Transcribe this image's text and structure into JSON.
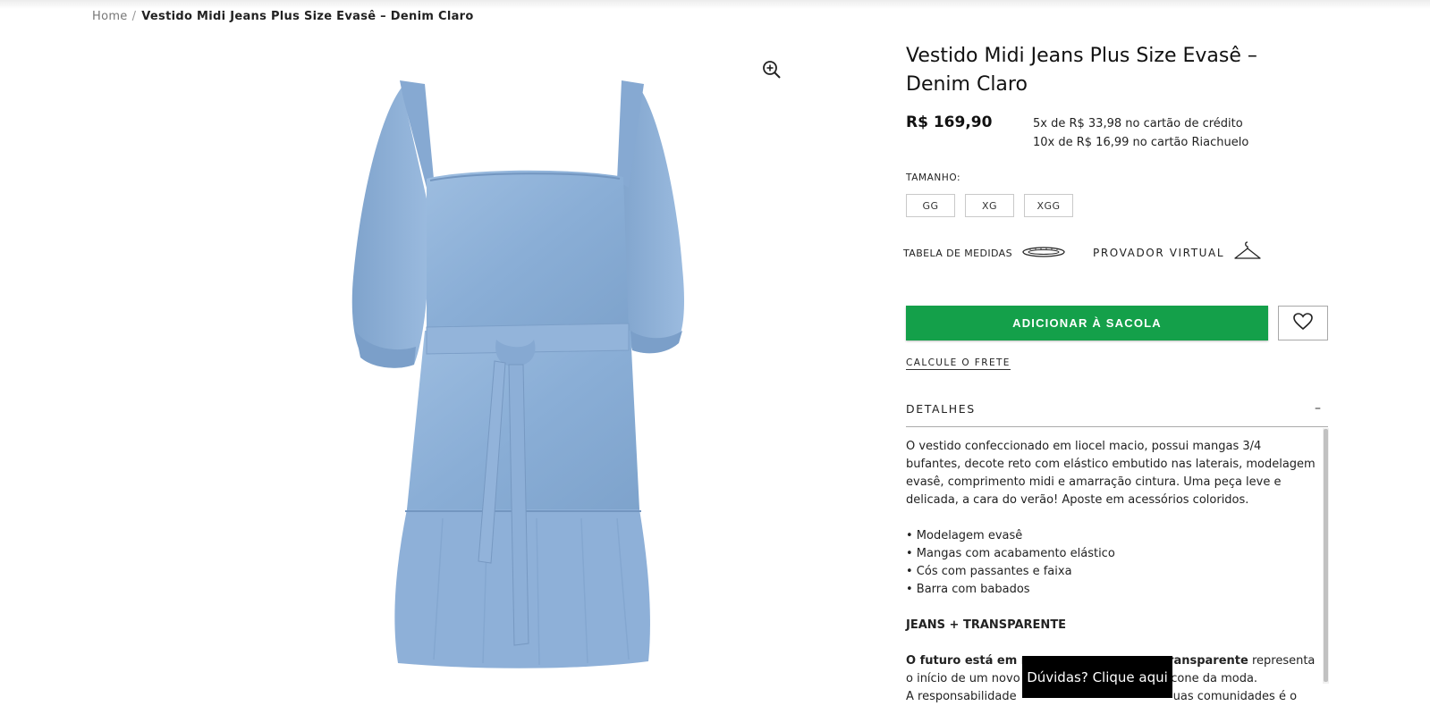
{
  "breadcrumb": {
    "home": "Home",
    "separator": "/",
    "current": "Vestido Midi Jeans Plus Size Evasê – Denim Claro"
  },
  "product": {
    "title": "Vestido Midi Jeans Plus Size Evasê – Denim Claro",
    "price": "R$ 169,90",
    "installments": [
      "5x de R$ 33,98 no cartão de crédito",
      "10x de R$ 16,99 no cartão Riachuelo"
    ],
    "image_icon": "denim-dress-image",
    "zoom_icon": "zoom-in-icon"
  },
  "size": {
    "label": "TAMANHO:",
    "options": [
      "GG",
      "XG",
      "XGG"
    ]
  },
  "links": {
    "measure_table": "TABELA DE MEDIDAS",
    "measure_icon": "tape-measure-icon",
    "virtual_fitting": "PROVADOR VIRTUAL",
    "virtual_icon": "hanger-icon",
    "freight": "CALCULE O FRETE"
  },
  "actions": {
    "add_to_bag": "ADICIONAR À SACOLA",
    "wishlist_icon": "heart-icon"
  },
  "details": {
    "title": "DETALHES",
    "toggle": "–",
    "description": "O vestido confeccionado em liocel macio, possui mangas 3/4 bufantes, decote reto com elástico embutido nas laterais, modelagem evasê, comprimento midi e amarração cintura. Uma peça leve e delicada, a cara do verão! Aposte em acessórios coloridos.",
    "bullets": [
      "• Modelagem evasê",
      "• Mangas com acabamento elástico",
      "• Cós com passantes e faixa",
      "• Barra com babados"
    ],
    "section_heading": "JEANS + TRANSPARENTE",
    "para_bold_start": "O futuro está em n",
    "para_bold_end": "ransparente",
    "para_rest_1": " representa",
    "line2_start": "o início de um novo",
    "line2_end": "ícone da moda.",
    "line3_start": "A responsabilidade",
    "line3_end": "uas comunidades é o"
  },
  "chat": {
    "label": "Dúvidas? Clique aqui"
  },
  "colors": {
    "accent_green": "#14a04a",
    "denim": "#8fb0d6"
  }
}
